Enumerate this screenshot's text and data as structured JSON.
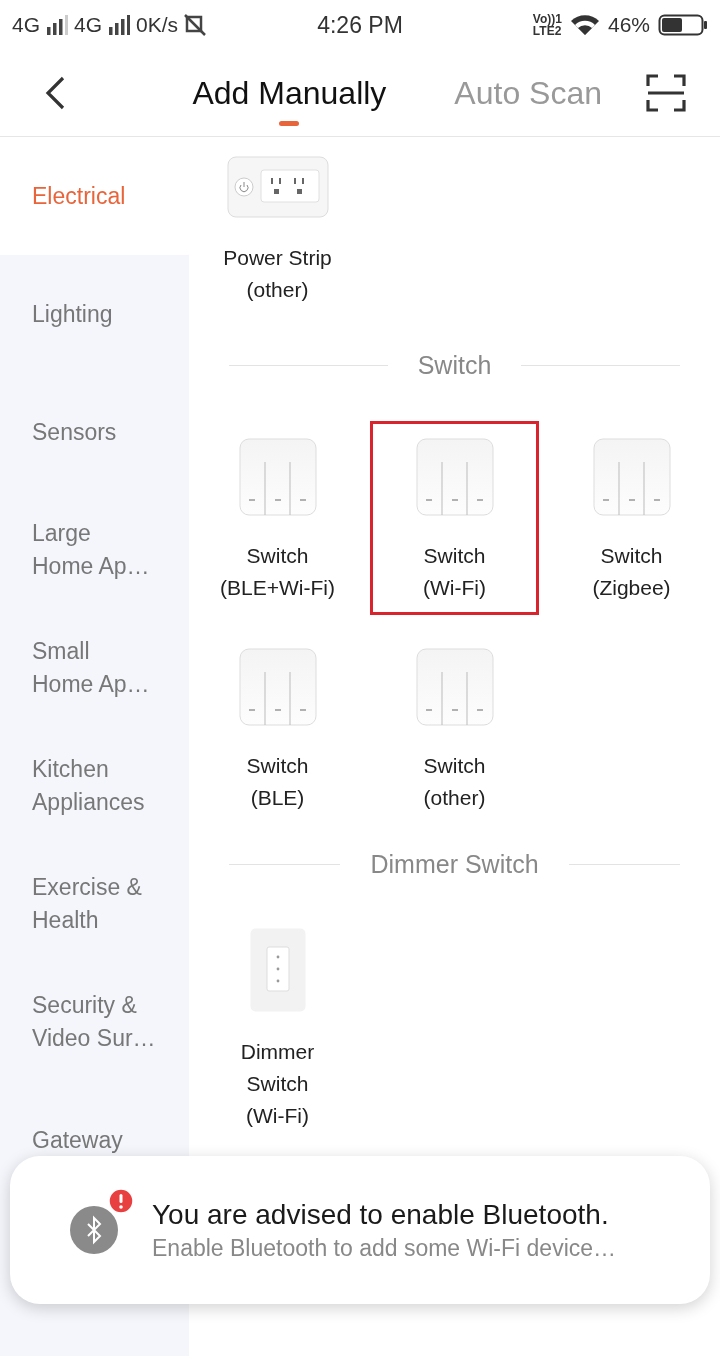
{
  "status_bar": {
    "networks": [
      "4G",
      "4G"
    ],
    "speed": "0K/s",
    "time": "4:26 PM",
    "volte": [
      "Vo))1",
      "LTE2"
    ],
    "battery": "46%"
  },
  "header": {
    "tabs": [
      {
        "label": "Add Manually",
        "selected": true
      },
      {
        "label": "Auto Scan",
        "selected": false
      }
    ]
  },
  "sidebar": {
    "items": [
      {
        "label": "Electrical",
        "selected": true
      },
      {
        "label": "Lighting",
        "selected": false
      },
      {
        "label": "Sensors",
        "selected": false
      },
      {
        "label": "Large\nHome Ap…",
        "selected": false
      },
      {
        "label": "Small\nHome Ap…",
        "selected": false
      },
      {
        "label": "Kitchen\nAppliances",
        "selected": false
      },
      {
        "label": "Exercise &\nHealth",
        "selected": false
      },
      {
        "label": "Security &\nVideo Sur…",
        "selected": false
      },
      {
        "label": "Gateway",
        "selected": false
      }
    ]
  },
  "sections": [
    {
      "items": [
        {
          "kind": "power-strip",
          "label": "Power Strip\n(other)",
          "highlighted": false
        }
      ]
    },
    {
      "title": "Switch",
      "items": [
        {
          "kind": "switch",
          "label": "Switch\n(BLE+Wi-Fi)",
          "highlighted": false
        },
        {
          "kind": "switch",
          "label": "Switch\n(Wi-Fi)",
          "highlighted": true
        },
        {
          "kind": "switch",
          "label": "Switch\n(Zigbee)",
          "highlighted": false
        },
        {
          "kind": "switch",
          "label": "Switch\n(BLE)",
          "highlighted": false
        },
        {
          "kind": "switch",
          "label": "Switch\n(other)",
          "highlighted": false
        }
      ]
    },
    {
      "title": "Dimmer Switch",
      "items": [
        {
          "kind": "dimmer",
          "label": "Dimmer\nSwitch\n(Wi-Fi)",
          "highlighted": false
        }
      ]
    }
  ],
  "toast": {
    "title": "You are advised to enable Bluetooth.",
    "message": "Enable Bluetooth to add some Wi-Fi device…"
  }
}
